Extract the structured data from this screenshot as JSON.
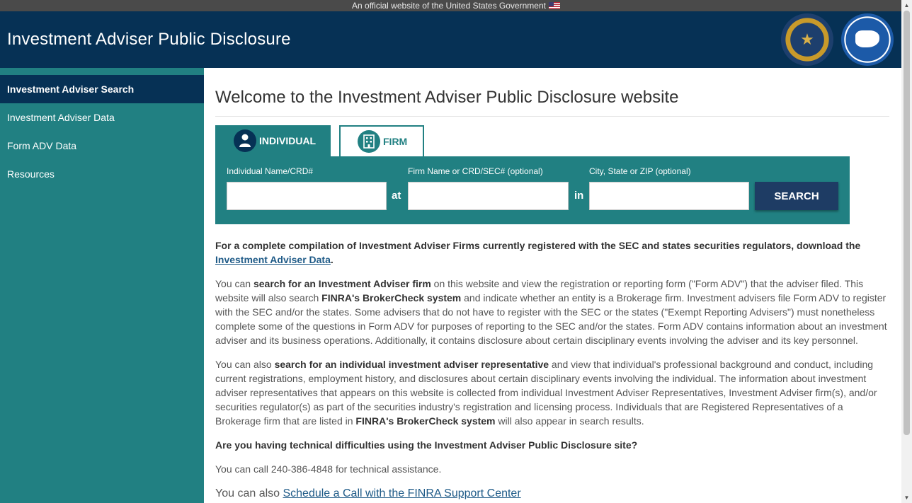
{
  "gov_banner": {
    "text": "An official website of the United States Government"
  },
  "header": {
    "title": "Investment Adviser Public Disclosure",
    "bg_color": "#063155"
  },
  "sidebar": {
    "bg_color": "#218082",
    "items": [
      {
        "label": "Investment Adviser Search",
        "active": true
      },
      {
        "label": "Investment Adviser Data",
        "active": false
      },
      {
        "label": "Form ADV Data",
        "active": false
      },
      {
        "label": "Resources",
        "active": false
      }
    ]
  },
  "main": {
    "heading": "Welcome to the Investment Adviser Public Disclosure website",
    "tabs": [
      {
        "label": "INDIVIDUAL",
        "icon": "person-icon",
        "selected": true
      },
      {
        "label": "FIRM",
        "icon": "building-icon",
        "selected": false
      }
    ],
    "search": {
      "fields": [
        {
          "label": "Individual Name/CRD#",
          "value": "",
          "placeholder": ""
        },
        {
          "label": "Firm Name or CRD/SEC# (optional)",
          "value": "",
          "placeholder": ""
        },
        {
          "label": "City, State or ZIP (optional)",
          "value": "",
          "placeholder": ""
        }
      ],
      "connector_at": "at",
      "connector_in": "in",
      "button_label": "SEARCH"
    },
    "intro": {
      "text": "For a complete compilation of Investment Adviser Firms currently registered with the SEC and states securities regulators, download the ",
      "link": "Investment Adviser Data",
      "end": "."
    },
    "para1": {
      "t1": "You can ",
      "b1": "search for an Investment Adviser firm",
      "t2": " on this website and view the registration or reporting form (\"Form ADV\") that the adviser filed. This website will also search ",
      "b2": "FINRA's BrokerCheck system",
      "t3": " and indicate whether an entity is a Brokerage firm. Investment advisers file Form ADV to register with the SEC and/or the states. Some advisers that do not have to register with the SEC or the states (\"Exempt Reporting Advisers\") must nonetheless complete some of the questions in Form ADV for purposes of reporting to the SEC and/or the states. Form ADV contains information about an investment adviser and its business operations. Additionally, it contains disclosure about certain disciplinary events involving the adviser and its key personnel."
    },
    "para2": {
      "t1": "You can also ",
      "b1": "search for an individual investment adviser representative",
      "t2": " and view that individual's professional background and conduct, including current registrations, employment history, and disclosures about certain disciplinary events involving the individual. The information about investment adviser representatives that appears on this website is collected from individual Investment Adviser Representatives, Investment Adviser firm(s), and/or securities regulator(s) as part of the securities industry's registration and licensing process. Individuals that are Registered Representatives of a Brokerage firm that are listed in ",
      "b2": "FINRA's BrokerCheck system",
      "t3": " will also appear in search results."
    },
    "tech_heading": "Are you having technical difficulties using the Investment Adviser Public Disclosure site?",
    "call_text": "You can call 240-386-4848 for technical assistance.",
    "schedule": {
      "prefix": "You can also ",
      "link": "Schedule a Call with the FINRA Support Center"
    }
  },
  "colors": {
    "accent": "#218082",
    "navy": "#063155",
    "button": "#1e3c64"
  }
}
